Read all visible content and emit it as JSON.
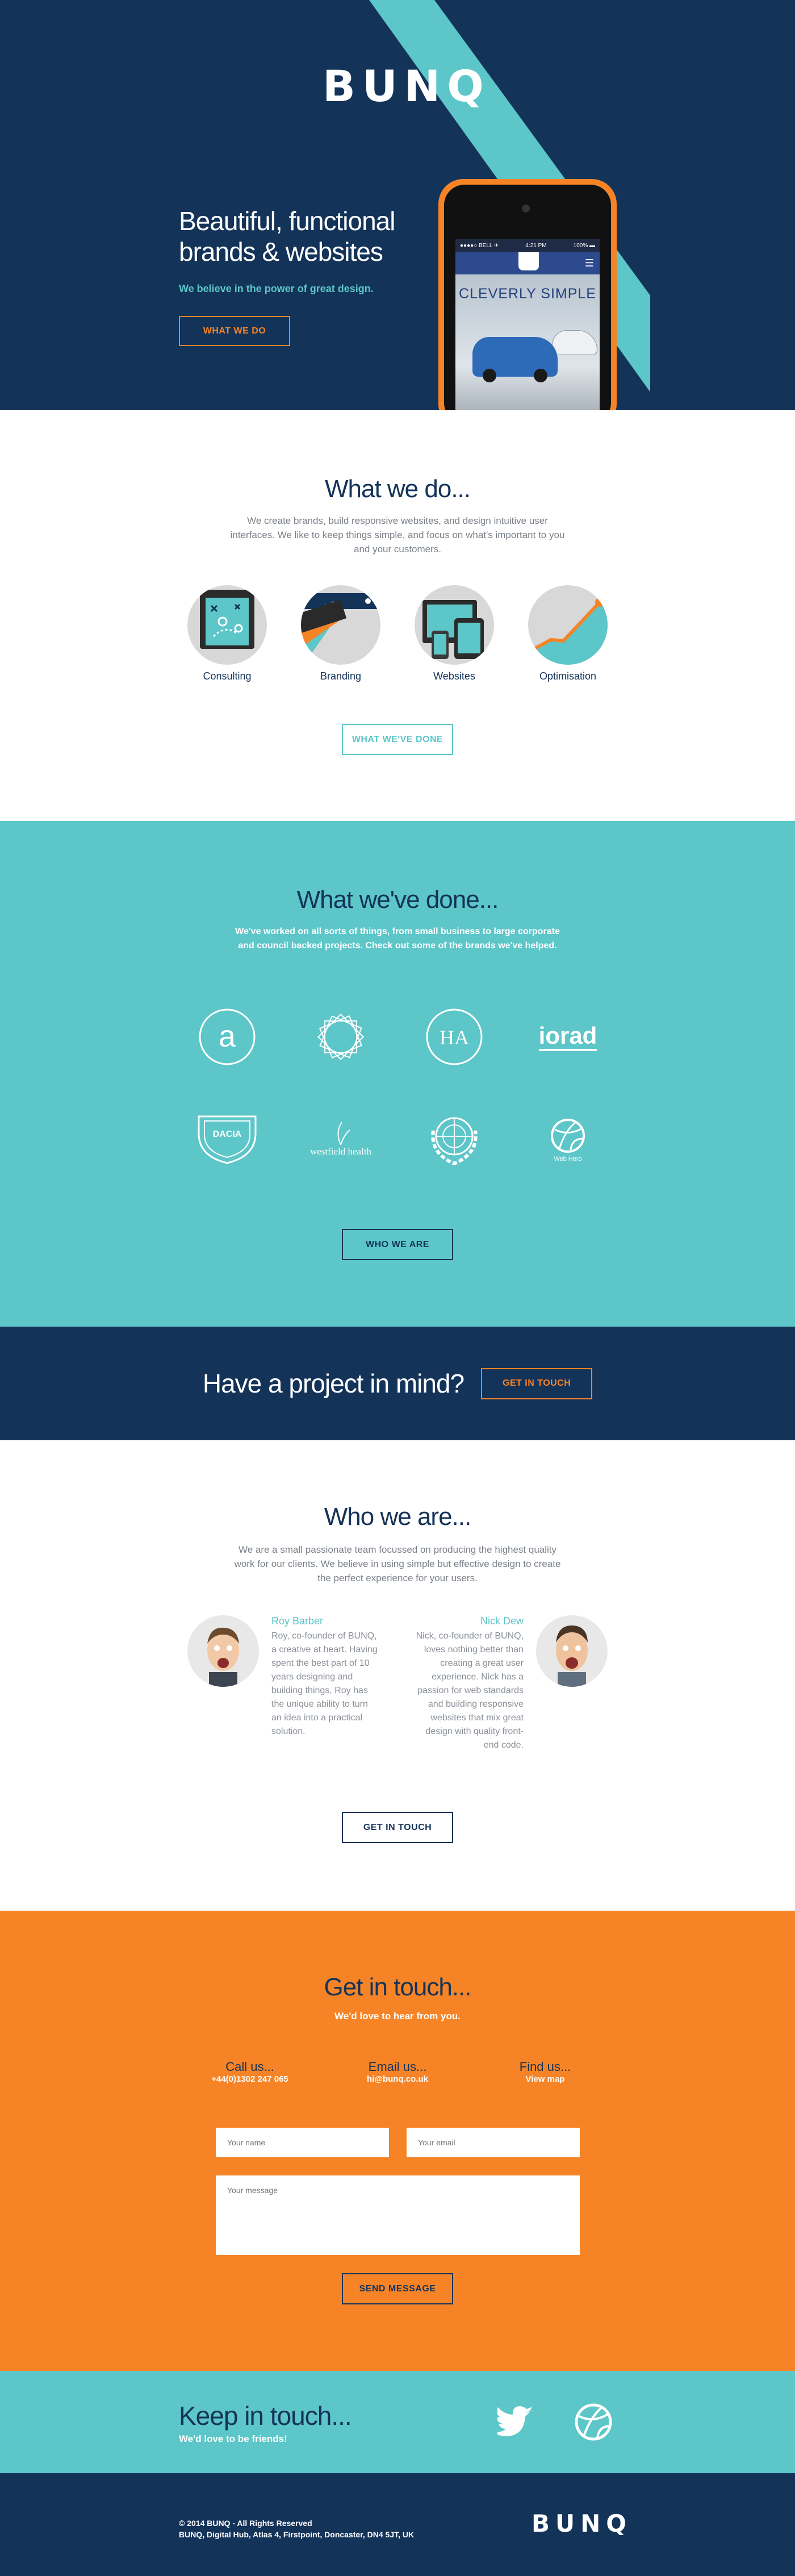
{
  "brand": {
    "logo_letters": [
      "B",
      "U",
      "N",
      "Q"
    ]
  },
  "colors": {
    "navy": "#143359",
    "teal": "#5cc6c8",
    "orange": "#f68426",
    "grey": "#7a8088"
  },
  "hero": {
    "title": "Beautiful, functional brands & websites",
    "subtitle": "We believe in the power of great design.",
    "cta": "WHAT WE DO",
    "phone": {
      "carrier": "●●●●○ BELL ✈",
      "time": "4:21 PM",
      "battery": "100% ▬",
      "headline": "CLEVERLY SIMPLE",
      "menu_icon": "hamburger-icon"
    }
  },
  "what_we_do": {
    "title": "What we do...",
    "text": "We create brands, build responsive websites, and design intuitive user interfaces. We like to keep things simple, and focus on what's important to you and your customers.",
    "services": [
      {
        "label": "Consulting",
        "icon": "tactics-board-icon"
      },
      {
        "label": "Branding",
        "icon": "colour-swatch-icon"
      },
      {
        "label": "Websites",
        "icon": "devices-icon"
      },
      {
        "label": "Optimisation",
        "icon": "growth-chart-icon"
      }
    ],
    "cta": "WHAT WE'VE DONE"
  },
  "what_weve_done": {
    "title": "What we've done...",
    "text": "We've worked on all sorts of things, from small business to large corporate and council backed projects. Check out some of the brands we've helped.",
    "clients": [
      {
        "name": "a",
        "icon": "a-circle-logo"
      },
      {
        "name": "",
        "icon": "star-mandala-logo"
      },
      {
        "name": "HA",
        "icon": "ha-circle-logo"
      },
      {
        "name": "iorad",
        "icon": "iorad-wordmark"
      },
      {
        "name": "DACIA",
        "icon": "dacia-badge-logo"
      },
      {
        "name": "westfield health",
        "icon": "westfield-health-logo"
      },
      {
        "name": "",
        "icon": "un-emblem-logo"
      },
      {
        "name": "Web Hero",
        "icon": "web-hero-logo"
      }
    ],
    "cta": "WHO WE ARE"
  },
  "project_cta": {
    "text": "Have a project in mind?",
    "cta": "GET IN TOUCH"
  },
  "who_we_are": {
    "title": "Who we are...",
    "text": "We are a small passionate team focussed on producing the highest quality work for our clients. We believe in using simple but effective design to create the perfect experience for your users.",
    "people": [
      {
        "name": "Roy Barber",
        "bio": "Roy, co-founder of BUNQ, a creative at heart. Having spent the best part of 10 years designing and building things, Roy has the unique ability to turn an idea into a practical solution."
      },
      {
        "name": "Nick Dew",
        "bio": "Nick, co-founder of BUNQ, loves nothing better than creating a great user experience. Nick has a passion for web standards and building responsive websites that mix great design with quality front-end code."
      }
    ],
    "cta": "GET IN TOUCH"
  },
  "get_in_touch": {
    "title": "Get in touch...",
    "subtitle": "We'd love to hear from you.",
    "contacts": [
      {
        "head": "Call us...",
        "value": "+44(0)1302 247 065"
      },
      {
        "head": "Email us...",
        "value": "hi@bunq.co.uk"
      },
      {
        "head": "Find us...",
        "value": "View map"
      }
    ],
    "form": {
      "name_placeholder": "Your name",
      "email_placeholder": "Your email",
      "message_placeholder": "Your message",
      "submit": "SEND MESSAGE"
    }
  },
  "keep_in_touch": {
    "title": "Keep in touch...",
    "subtitle": "We'd love to be friends!",
    "social": [
      {
        "icon": "twitter-icon"
      },
      {
        "icon": "dribbble-icon"
      }
    ]
  },
  "footer": {
    "copyright": "© 2014 BUNQ - All Rights Reserved",
    "address": "BUNQ, Digital Hub, Atlas 4, Firstpoint, Doncaster, DN4 5JT, UK"
  }
}
